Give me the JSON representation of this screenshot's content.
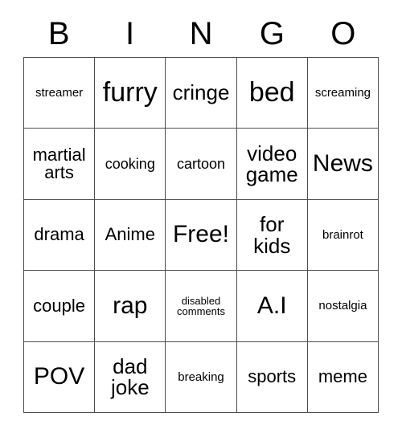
{
  "card": {
    "title": "BINGO",
    "columns": [
      "B",
      "I",
      "N",
      "G",
      "O"
    ],
    "free_space_label": "Free!",
    "free_space_position": {
      "row": 2,
      "col": 2
    },
    "grid_size": "5x5",
    "colors": {
      "background": "#ffffff",
      "text": "#000000",
      "border": "#4d4d4d"
    },
    "rows": [
      {
        "cells": [
          {
            "text": "streamer",
            "size": "xs"
          },
          {
            "text": "furry",
            "size": "xxl"
          },
          {
            "text": "cringe",
            "size": "lg"
          },
          {
            "text": "bed",
            "size": "xxl"
          },
          {
            "text": "screaming",
            "size": "xs"
          }
        ]
      },
      {
        "cells": [
          {
            "text": "martial\narts",
            "size": "md"
          },
          {
            "text": "cooking",
            "size": "sm"
          },
          {
            "text": "cartoon",
            "size": "sm"
          },
          {
            "text": "video\ngame",
            "size": "lg"
          },
          {
            "text": "News",
            "size": "xl"
          }
        ]
      },
      {
        "cells": [
          {
            "text": "drama",
            "size": "md"
          },
          {
            "text": "Anime",
            "size": "md"
          },
          {
            "text": "Free!",
            "size": "xl"
          },
          {
            "text": "for\nkids",
            "size": "lg"
          },
          {
            "text": "brainrot",
            "size": "xs"
          }
        ]
      },
      {
        "cells": [
          {
            "text": "couple",
            "size": "md"
          },
          {
            "text": "rap",
            "size": "xl"
          },
          {
            "text": "disabled\ncomments",
            "size": "xxs"
          },
          {
            "text": "A.I",
            "size": "xl"
          },
          {
            "text": "nostalgia",
            "size": "xs"
          }
        ]
      },
      {
        "cells": [
          {
            "text": "POV",
            "size": "xl"
          },
          {
            "text": "dad\njoke",
            "size": "lg"
          },
          {
            "text": "breaking",
            "size": "xs"
          },
          {
            "text": "sports",
            "size": "md"
          },
          {
            "text": "meme",
            "size": "md"
          }
        ]
      }
    ]
  }
}
